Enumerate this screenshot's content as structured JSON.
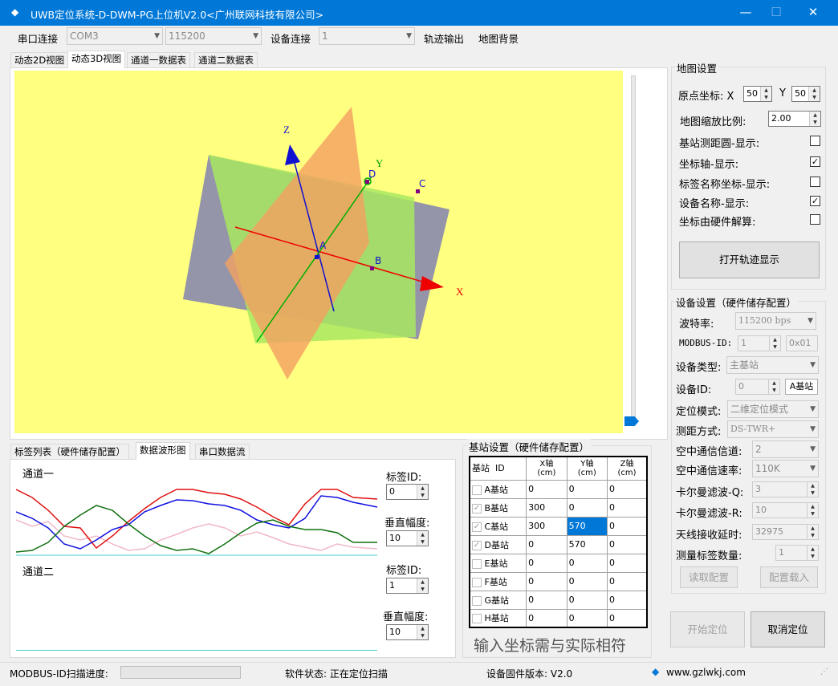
{
  "titlebar": {
    "logo": "◆",
    "title": "UWB定位系统-D-DWM-PG上位机V2.0<广州联网科技有限公司>",
    "minimize": "—",
    "maximize": "☐",
    "close": "✕"
  },
  "toolbar": {
    "serial_label": "串口连接",
    "com_value": "COM3",
    "baud_value": "115200",
    "device_label": "设备连接",
    "device_value": "1",
    "track_output": "轨迹输出",
    "map_bg": "地图背景"
  },
  "view_tabs": [
    "动态2D视图",
    "动态3D视图",
    "通道一数据表",
    "通道二数据表"
  ],
  "view3d": {
    "axis_z": "Z",
    "axis_y": "Y",
    "axis_x": "X",
    "label_a": "A",
    "label_b": "B",
    "label_c": "C",
    "label_d": "D",
    "bg_color": "#ffff80",
    "colors": {
      "orange": "#f4a060",
      "green": "#a8e860",
      "slate": "#8c8cae"
    }
  },
  "bottom_tabs": [
    "标签列表（硬件储存配置）",
    "数据波形图",
    "串口数据流"
  ],
  "wave": {
    "channel1": "通道一",
    "channel2": "通道二",
    "tag_id_label_1": "标签ID:",
    "tag_id_value_1": "0",
    "vamp_label_1": "垂直幅度:",
    "vamp_value_1": "10",
    "tag_id_label_2": "标签ID:",
    "tag_id_value_2": "1",
    "vamp_label_2": "垂直幅度:",
    "vamp_value_2": "10"
  },
  "base_station": {
    "title": "基站设置（硬件储存配置）",
    "headers": {
      "station": "基站",
      "id": "ID",
      "x1": "X轴",
      "x2": "(cm)",
      "y1": "Y轴",
      "y2": "(cm)",
      "z1": "Z轴",
      "z2": "(cm)"
    },
    "rows": [
      {
        "chk": "",
        "name": "A基站",
        "x": "0",
        "y": "0",
        "z": "0"
      },
      {
        "chk": "✓",
        "name": "B基站",
        "x": "300",
        "y": "0",
        "z": "0"
      },
      {
        "chk": "✓",
        "name": "C基站",
        "x": "300",
        "y": "570",
        "z": "0"
      },
      {
        "chk": "✓",
        "name": "D基站",
        "x": "0",
        "y": "570",
        "z": "0"
      },
      {
        "chk": "",
        "name": "E基站",
        "x": "0",
        "y": "0",
        "z": "0"
      },
      {
        "chk": "",
        "name": "F基站",
        "x": "0",
        "y": "0",
        "z": "0"
      },
      {
        "chk": "",
        "name": "G基站",
        "x": "0",
        "y": "0",
        "z": "0"
      },
      {
        "chk": "",
        "name": "H基站",
        "x": "0",
        "y": "0",
        "z": "0"
      }
    ],
    "note": "输入坐标需与实际相符"
  },
  "map_settings": {
    "title": "地图设置",
    "origin_label": "原点坐标: X",
    "origin_x": "50",
    "origin_y_label": "Y",
    "origin_y": "50",
    "scale_label": "地图缩放比例:",
    "scale_value": "2.00",
    "opt1": "基站测距圆-显示:",
    "opt1_check": "",
    "opt2": "坐标轴-显示:",
    "opt2_check": "✓",
    "opt3": "标签名称坐标-显示:",
    "opt3_check": "",
    "opt4": "设备名称-显示:",
    "opt4_check": "✓",
    "opt5": "坐标由硬件解算:",
    "opt5_check": "",
    "open_track": "打开轨迹显示"
  },
  "device_settings": {
    "title": "设备设置（硬件储存配置）",
    "baud_label": "波特率:",
    "baud_value": "115200 bps",
    "modbus_label": "MODBUS-ID:",
    "modbus_value": "1",
    "modbus_hex": "0x01",
    "type_label": "设备类型:",
    "type_value": "主基站",
    "devid_label": "设备ID:",
    "devid_value": "0",
    "devid_btn": "A基站",
    "mode_label": "定位模式:",
    "mode_value": "二维定位模式",
    "range_label": "测距方式:",
    "range_value": "DS-TWR+",
    "channel_label": "空中通信信道:",
    "channel_value": "2",
    "rate_label": "空中通信速率:",
    "rate_value": "110K",
    "kq_label": "卡尔曼滤波-Q:",
    "kq_value": "3",
    "kr_label": "卡尔曼滤波-R:",
    "kr_value": "10",
    "delay_label": "天线接收延时:",
    "delay_value": "32975",
    "count_label": "测量标签数量:",
    "count_value": "1",
    "read_btn": "读取配置",
    "write_btn": "配置载入"
  },
  "actions": {
    "start": "开始定位",
    "cancel": "取消定位"
  },
  "status": {
    "scan_label": "MODBUS-ID扫描进度:",
    "soft_state": "软件状态: 正在定位扫描",
    "firmware": "设备固件版本: V2.0",
    "website": "www.gzlwkj.com"
  }
}
